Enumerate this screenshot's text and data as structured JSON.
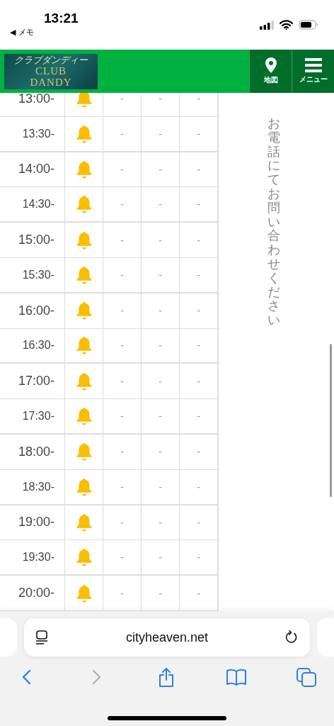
{
  "status_bar": {
    "time": "13:21",
    "back_link": "◀ メモ"
  },
  "header": {
    "logo": {
      "kana": "クラブダンディー",
      "line_1": "CLUB",
      "line_2": "DANDY"
    },
    "buttons": [
      {
        "kind": "map",
        "label": "地図"
      },
      {
        "kind": "menu",
        "label": "メニュー"
      }
    ]
  },
  "schedule": {
    "rows": [
      {
        "time": "13:00-",
        "cells": [
          "-",
          "-",
          "-"
        ]
      },
      {
        "time": "13:30-",
        "cells": [
          "-",
          "-",
          "-"
        ]
      },
      {
        "time": "14:00-",
        "cells": [
          "-",
          "-",
          "-"
        ]
      },
      {
        "time": "14:30-",
        "cells": [
          "-",
          "-",
          "-"
        ]
      },
      {
        "time": "15:00-",
        "cells": [
          "-",
          "-",
          "-"
        ]
      },
      {
        "time": "15:30-",
        "cells": [
          "-",
          "-",
          "-"
        ]
      },
      {
        "time": "16:00-",
        "cells": [
          "-",
          "-",
          "-"
        ]
      },
      {
        "time": "16:30-",
        "cells": [
          "-",
          "-",
          "-"
        ]
      },
      {
        "time": "17:00-",
        "cells": [
          "-",
          "-",
          "-"
        ]
      },
      {
        "time": "17:30-",
        "cells": [
          "-",
          "-",
          "-"
        ]
      },
      {
        "time": "18:00-",
        "cells": [
          "-",
          "-",
          "-"
        ]
      },
      {
        "time": "18:30-",
        "cells": [
          "-",
          "-",
          "-"
        ]
      },
      {
        "time": "19:00-",
        "cells": [
          "-",
          "-",
          "-"
        ]
      },
      {
        "time": "19:30-",
        "cells": [
          "-",
          "-",
          "-"
        ]
      },
      {
        "time": "20:00-",
        "cells": [
          "-",
          "-",
          "-"
        ]
      }
    ],
    "notice": "お電話にてお問い合わせください"
  },
  "browser": {
    "url": "cityheaven.net",
    "toolbar": [
      {
        "kind": "back",
        "disabled": false
      },
      {
        "kind": "forward",
        "disabled": true
      },
      {
        "kind": "share",
        "disabled": false
      },
      {
        "kind": "bookmarks",
        "disabled": false
      },
      {
        "kind": "tabs",
        "disabled": false
      }
    ]
  }
}
